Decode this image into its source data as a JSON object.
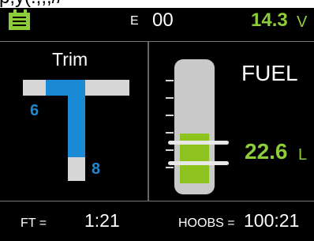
{
  "top_strip": {
    "text": "p,y(.,,,//"
  },
  "header": {
    "battery_icon": "battery-icon",
    "engine_label": "E",
    "engine_value": "00",
    "voltage_value": "14.3",
    "voltage_unit": "V"
  },
  "trim": {
    "title": "Trim",
    "left_value": "6",
    "bottom_value": "8"
  },
  "fuel": {
    "title": "FUEL",
    "value": "22.6",
    "unit": "L"
  },
  "footer": {
    "flight_time_label": "FT =",
    "flight_time_value": "1:21",
    "hoobs_label": "HOOBS =",
    "hoobs_value": "100:21"
  },
  "colors": {
    "accent_green": "#8dcd3a",
    "trim_blue": "#1a8ad4",
    "background": "#000000",
    "gauge_gray": "#c9c9c9"
  }
}
